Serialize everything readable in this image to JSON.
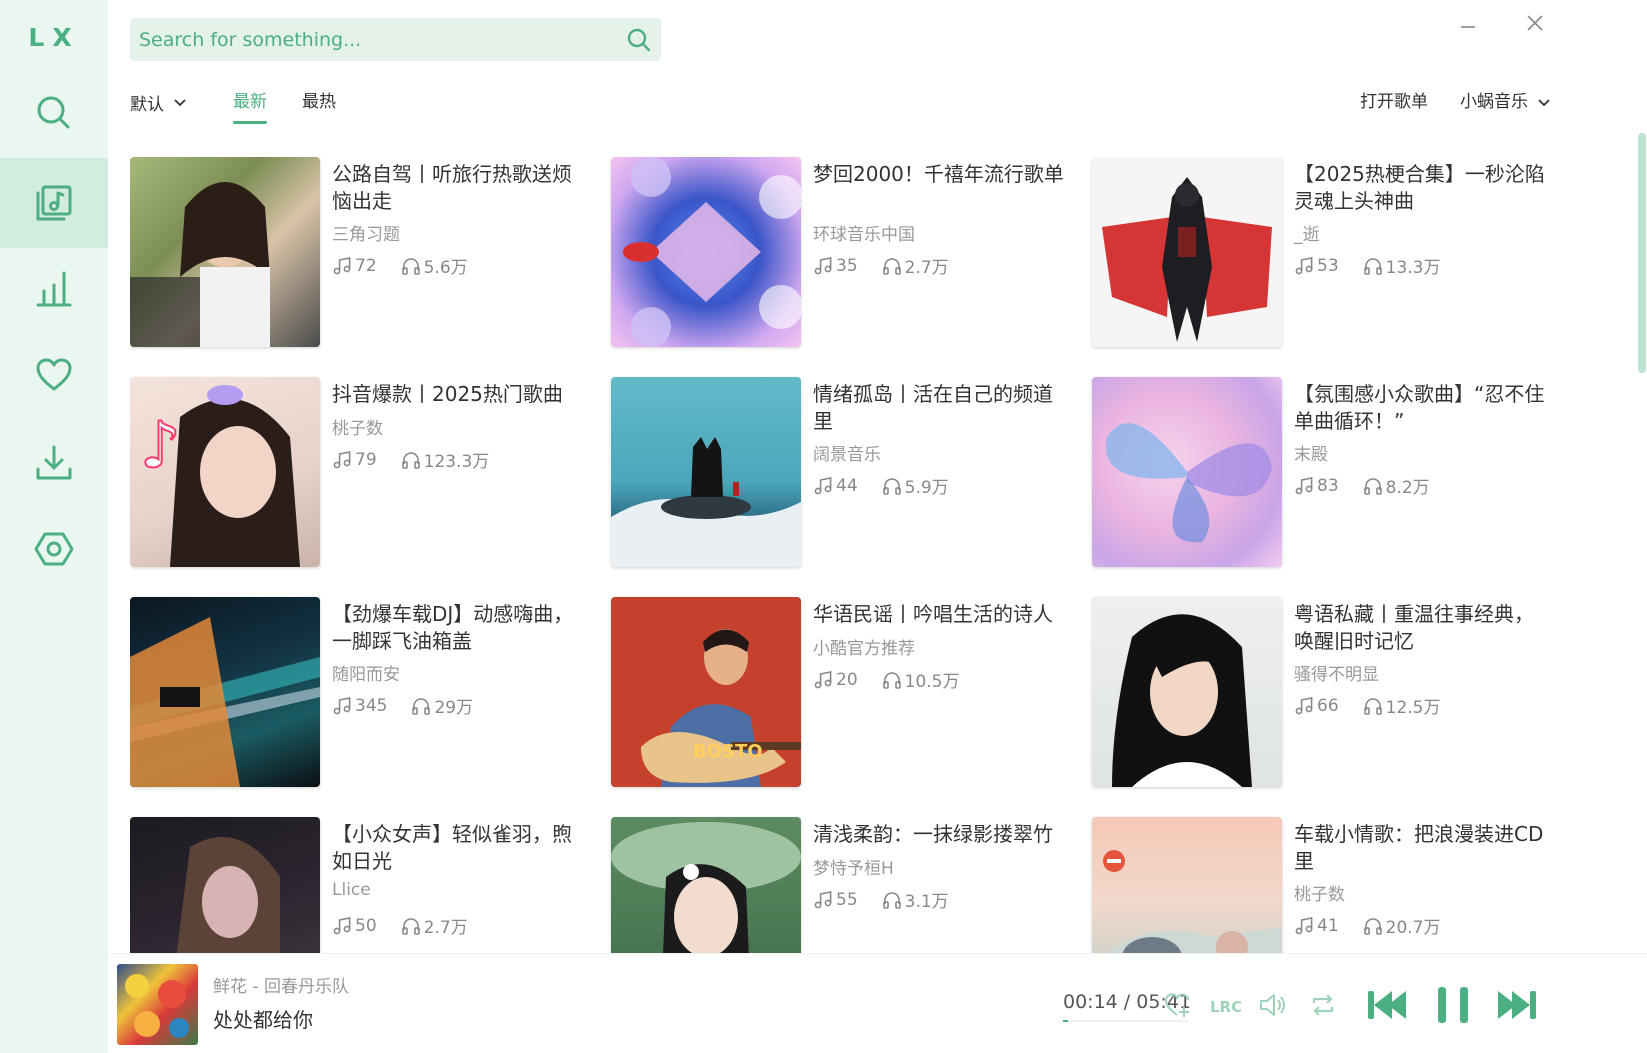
{
  "app": {
    "logo": "LX"
  },
  "search": {
    "placeholder": "Search for something..."
  },
  "sidebar": {
    "items": [
      {
        "name": "search",
        "icon": "search-icon"
      },
      {
        "name": "songlist",
        "icon": "music-list-icon",
        "active": true
      },
      {
        "name": "leaderboard",
        "icon": "bar-chart-icon"
      },
      {
        "name": "favorites",
        "icon": "heart-icon"
      },
      {
        "name": "download",
        "icon": "download-icon"
      },
      {
        "name": "settings",
        "icon": "settings-icon"
      }
    ]
  },
  "toolbar": {
    "sort_label": "默认",
    "tabs": [
      {
        "label": "最新",
        "active": true
      },
      {
        "label": "最热",
        "active": false
      }
    ],
    "open_playlist_label": "打开歌单",
    "source_label": "小蜗音乐"
  },
  "playlists": [
    {
      "title": "公路自驾丨听旅行热歌送烦恼出走",
      "author": "三角习题",
      "songs": "72",
      "plays": "5.6万"
    },
    {
      "title": "梦回2000！千禧年流行歌单",
      "author": "环球音乐中国",
      "songs": "35",
      "plays": "2.7万"
    },
    {
      "title": "【2025热梗合集】一秒沦陷灵魂上头神曲",
      "author": "_逝",
      "songs": "53",
      "plays": "13.3万"
    },
    {
      "title": "抖音爆款丨2025热门歌曲",
      "author": "桃子数",
      "songs": "79",
      "plays": "123.3万"
    },
    {
      "title": "情绪孤岛丨活在自己的频道里",
      "author": "阔景音乐",
      "songs": "44",
      "plays": "5.9万"
    },
    {
      "title": "【氛围感小众歌曲】“忍不住单曲循环！”",
      "author": "末殿",
      "songs": "83",
      "plays": "8.2万"
    },
    {
      "title": "【劲爆车载DJ】动感嗨曲，一脚踩飞油箱盖",
      "author": "随阳而安",
      "songs": "345",
      "plays": "29万"
    },
    {
      "title": "华语民谣丨吟唱生活的诗人",
      "author": "小酷官方推荐",
      "songs": "20",
      "plays": "10.5万"
    },
    {
      "title": "粤语私藏丨重温往事经典，唤醒旧时记忆",
      "author": "骚得不明显",
      "songs": "66",
      "plays": "12.5万"
    },
    {
      "title": "【小众女声】轻似雀羽，煦如日光",
      "author": "Llice",
      "songs": "50",
      "plays": "2.7万"
    },
    {
      "title": "清浅柔韵：一抹绿影搂翠竹",
      "author": "梦恃予桓H",
      "songs": "55",
      "plays": "3.1万"
    },
    {
      "title": "车载小情歌：把浪漫装进CD里",
      "author": "桃子数",
      "songs": "41",
      "plays": "20.7万"
    }
  ],
  "player": {
    "track": "鲜花 - 回春丹乐队",
    "lyric": "处处都给你",
    "time": "00:14 / 05:41",
    "progress": 0.041
  },
  "colors": {
    "accent": "#4caf82",
    "sidebar_bg": "#eaf6f0",
    "active_bg": "#d3ece0"
  }
}
